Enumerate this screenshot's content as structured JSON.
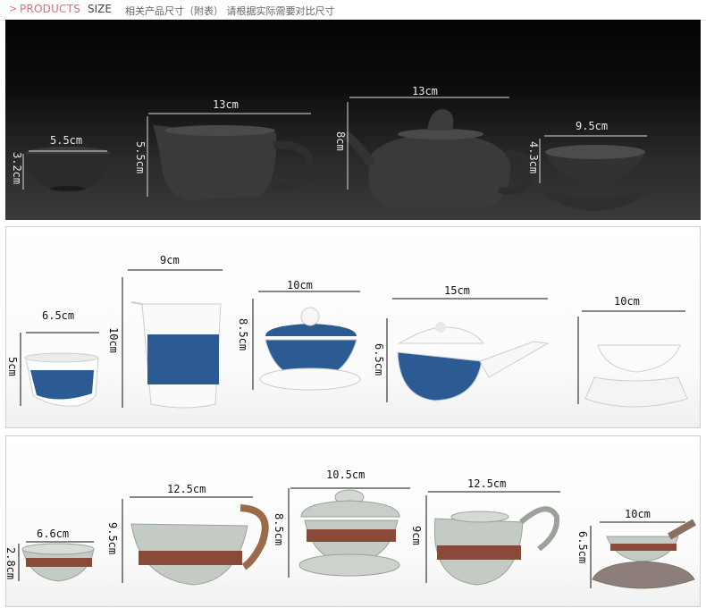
{
  "header": {
    "arrow": ">",
    "products": "PRODUCTS",
    "size": "SIZE",
    "note": "相关产品尺寸（附表）  请根据实际需要对比尺寸"
  },
  "colors": {
    "header_accent": "#e06a77",
    "dark_clay": "#2a2a2a",
    "blue_white": "#2c5a93",
    "celadon": "#c4cbc4",
    "copper_band": "#8a4a3a"
  },
  "panel1": {
    "cup_w": "5.5cm",
    "cup_h": "3.2cm",
    "pitcher_w": "13cm",
    "pitcher_h": "5.5cm",
    "teapot_w": "13cm",
    "teapot_h": "8cm",
    "strainer_w": "9.5cm",
    "strainer_h": "4.3cm"
  },
  "panel2": {
    "cup_w": "6.5cm",
    "cup_h": "5cm",
    "pitcher_w": "9cm",
    "pitcher_h": "10cm",
    "gaiwan_w": "10cm",
    "gaiwan_h": "8.5cm",
    "teapot_w": "15cm",
    "teapot_h": "6.5cm",
    "strainer_w": "10cm"
  },
  "panel3": {
    "cup_w": "6.6cm",
    "cup_h": "2.8cm",
    "pitcher_w": "12.5cm",
    "pitcher_h": "9.5cm",
    "gaiwan_w": "10.5cm",
    "gaiwan_h": "8.5cm",
    "teapot_w": "12.5cm",
    "teapot_h": "9cm",
    "strainer_w": "10cm",
    "strainer_h": "6.5cm"
  }
}
